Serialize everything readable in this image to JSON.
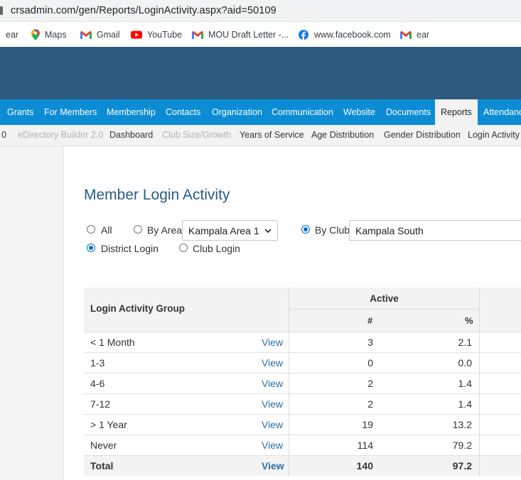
{
  "browser": {
    "url": "crsadmin.com/gen/Reports/LoginActivity.aspx?aid=50109",
    "bookmarks": [
      {
        "label": "ear",
        "icon": "none"
      },
      {
        "label": "Maps",
        "icon": "maps-icon"
      },
      {
        "label": "Gmail",
        "icon": "gmail-icon"
      },
      {
        "label": "YouTube",
        "icon": "youtube-icon"
      },
      {
        "label": "MOU Draft Letter -...",
        "icon": "gmail-icon"
      },
      {
        "label": "www.facebook.com",
        "icon": "facebook-icon"
      },
      {
        "label": "ear",
        "icon": "gmail-icon"
      }
    ]
  },
  "nav": {
    "items": [
      "Grants",
      "For Members",
      "Membership",
      "Contacts",
      "Organization",
      "Communication",
      "Website",
      "Documents",
      "Reports",
      "Attendance"
    ],
    "active": "Reports"
  },
  "subnav": {
    "items": [
      "0",
      "eDirectory Builder 2.0",
      "Dashboard",
      "Club Size/Growth",
      "Years of Service",
      "Age Distribution",
      "Gender Distribution",
      "Login Activity"
    ]
  },
  "page": {
    "title": "Member Login Activity",
    "filters": {
      "all_label": "All",
      "by_area_label": "By Area",
      "area_value": "Kampala Area 1",
      "by_club_label": "By Club",
      "club_value": "Kampala South",
      "district_login_label": "District Login",
      "club_login_label": "Club Login",
      "selected_scope": "By Club",
      "selected_login": "District Login"
    }
  },
  "table": {
    "group_header": "Login Activity Group",
    "active_header": "Active",
    "count_header": "#",
    "percent_header": "%",
    "rows": [
      {
        "group": "< 1 Month",
        "link": "View",
        "count": "3",
        "percent": "2.1"
      },
      {
        "group": "1-3",
        "link": "View",
        "count": "0",
        "percent": "0.0"
      },
      {
        "group": "4-6",
        "link": "View",
        "count": "2",
        "percent": "1.4"
      },
      {
        "group": "7-12",
        "link": "View",
        "count": "2",
        "percent": "1.4"
      },
      {
        "group": "> 1 Year",
        "link": "View",
        "count": "19",
        "percent": "13.2"
      },
      {
        "group": "Never",
        "link": "View",
        "count": "114",
        "percent": "79.2"
      }
    ],
    "total": {
      "group": "Total",
      "link": "View",
      "count": "140",
      "percent": "97.2"
    }
  },
  "colors": {
    "banner": "#2d5b80",
    "nav": "#0c8cd4",
    "title": "#275d84",
    "link": "#2a6f9f"
  }
}
